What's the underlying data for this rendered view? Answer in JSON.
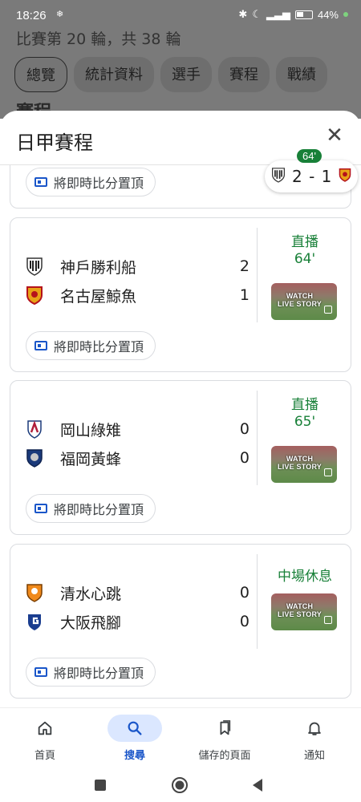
{
  "status_bar": {
    "time": "18:26",
    "battery": "44%"
  },
  "background_page": {
    "subtitle": "比賽第 20 輪，共 38 輪",
    "tabs": [
      {
        "label": "總覽",
        "selected": true
      },
      {
        "label": "統計資料",
        "selected": false
      },
      {
        "label": "選手",
        "selected": false
      },
      {
        "label": "賽程",
        "selected": false
      },
      {
        "label": "戰績",
        "selected": false
      }
    ],
    "heading": "賽程"
  },
  "sheet": {
    "title": "日甲賽程",
    "close_label": "✕",
    "pin_label": "將即時比分置頂"
  },
  "floating_chip": {
    "minute": "64'",
    "score": "2 - 1"
  },
  "matches": [
    {
      "home": {
        "name": "神戶勝利船",
        "score": "2",
        "crest_color": "#b5121b"
      },
      "away": {
        "name": "名古屋鯨魚",
        "score": "1",
        "crest_color": "#e8a317"
      },
      "status_line1": "直播",
      "status_line2": "64'",
      "thumb_text": "WATCH LIVE STORY"
    },
    {
      "home": {
        "name": "岡山綠雉",
        "score": "0",
        "crest_color": "#b01e3a"
      },
      "away": {
        "name": "福岡黃蜂",
        "score": "0",
        "crest_color": "#1b3a7a"
      },
      "status_line1": "直播",
      "status_line2": "65'",
      "thumb_text": "WATCH LIVE STORY"
    },
    {
      "home": {
        "name": "清水心跳",
        "score": "0",
        "crest_color": "#f08a1c"
      },
      "away": {
        "name": "大阪飛腳",
        "score": "0",
        "crest_color": "#1a3d8f"
      },
      "status_line1": "中場休息",
      "thumb_text": "WATCH LIVE STORY"
    }
  ],
  "bottom_nav": [
    {
      "label": "首頁",
      "icon": "home-icon",
      "active": false
    },
    {
      "label": "搜尋",
      "icon": "search-icon",
      "active": true
    },
    {
      "label": "儲存的頁面",
      "icon": "bookmarks-icon",
      "active": false
    },
    {
      "label": "通知",
      "icon": "bell-icon",
      "active": false
    }
  ],
  "colors": {
    "live_green": "#188038",
    "accent_blue": "#1a56c9",
    "active_pill": "#dbe7ff"
  }
}
